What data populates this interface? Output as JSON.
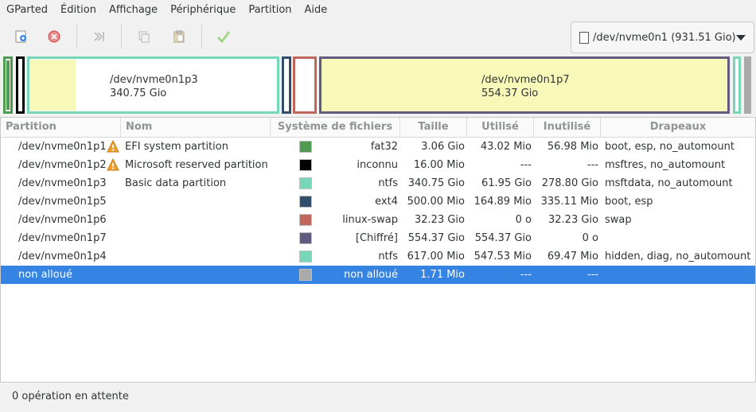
{
  "menu": [
    "GParted",
    "Édition",
    "Affichage",
    "Périphérique",
    "Partition",
    "Aide"
  ],
  "toolbar": {
    "buttons": [
      {
        "name": "new-partition-icon"
      },
      {
        "name": "delete-partition-icon"
      },
      {
        "name": "resize-move-icon"
      },
      {
        "name": "copy-icon"
      },
      {
        "name": "paste-icon"
      },
      {
        "name": "apply-icon"
      }
    ],
    "device_label": "/dev/nvme0n1 (931.51 Gio)"
  },
  "pbar": {
    "p3": {
      "name": "/dev/nvme0n1p3",
      "size": "340.75 Gio"
    },
    "p7": {
      "name": "/dev/nvme0n1p7",
      "size": "554.37 Gio"
    }
  },
  "columns": [
    "Partition",
    "Nom",
    "Système de fichiers",
    "Taille",
    "Utilisé",
    "Inutilisé",
    "Drapeaux"
  ],
  "rows": [
    {
      "partition": "/dev/nvme0n1p1",
      "warn": true,
      "nom": "EFI system partition",
      "color": "#4e9a4e",
      "fs": "fat32",
      "taille": "3.06 Gio",
      "utilise": "43.02 Mio",
      "inutilise": "56.98 Mio",
      "drapeaux": "boot, esp, no_automount"
    },
    {
      "partition": "/dev/nvme0n1p2",
      "warn": true,
      "nom": "Microsoft reserved partition",
      "color": "#000000",
      "fs": "inconnu",
      "taille": "16.00 Mio",
      "utilise": "---",
      "inutilise": "---",
      "drapeaux": "msftres, no_automount"
    },
    {
      "partition": "/dev/nvme0n1p3",
      "warn": false,
      "nom": "Basic data partition",
      "color": "#76d7b8",
      "fs": "ntfs",
      "taille": "340.75 Gio",
      "utilise": "61.95 Gio",
      "inutilise": "278.80 Gio",
      "drapeaux": "msftdata, no_automount"
    },
    {
      "partition": "/dev/nvme0n1p5",
      "warn": false,
      "nom": "",
      "color": "#314e6c",
      "fs": "ext4",
      "taille": "500.00 Mio",
      "utilise": "164.89 Mio",
      "inutilise": "335.11 Mio",
      "drapeaux": "boot, esp"
    },
    {
      "partition": "/dev/nvme0n1p6",
      "warn": false,
      "nom": "",
      "color": "#c1665a",
      "fs": "linux-swap",
      "taille": "32.23 Gio",
      "utilise": "0 o",
      "inutilise": "32.23 Gio",
      "drapeaux": "swap"
    },
    {
      "partition": "/dev/nvme0n1p7",
      "warn": false,
      "nom": "",
      "color": "#625b81",
      "fs": "[Chiffré]",
      "taille": "554.37 Gio",
      "utilise": "554.37 Gio",
      "inutilise": "0 o",
      "drapeaux": ""
    },
    {
      "partition": "/dev/nvme0n1p4",
      "warn": false,
      "nom": "",
      "color": "#76d7b8",
      "fs": "ntfs",
      "taille": "617.00 Mio",
      "utilise": "547.53 Mio",
      "inutilise": "69.47 Mio",
      "drapeaux": "hidden, diag, no_automount"
    },
    {
      "partition": "non alloué",
      "warn": false,
      "nom": "",
      "color": "#a9a9a9",
      "fs": "non alloué",
      "taille": "1.71 Mio",
      "utilise": "---",
      "inutilise": "---",
      "drapeaux": "",
      "selected": true
    }
  ],
  "status": "0 opération en attente"
}
